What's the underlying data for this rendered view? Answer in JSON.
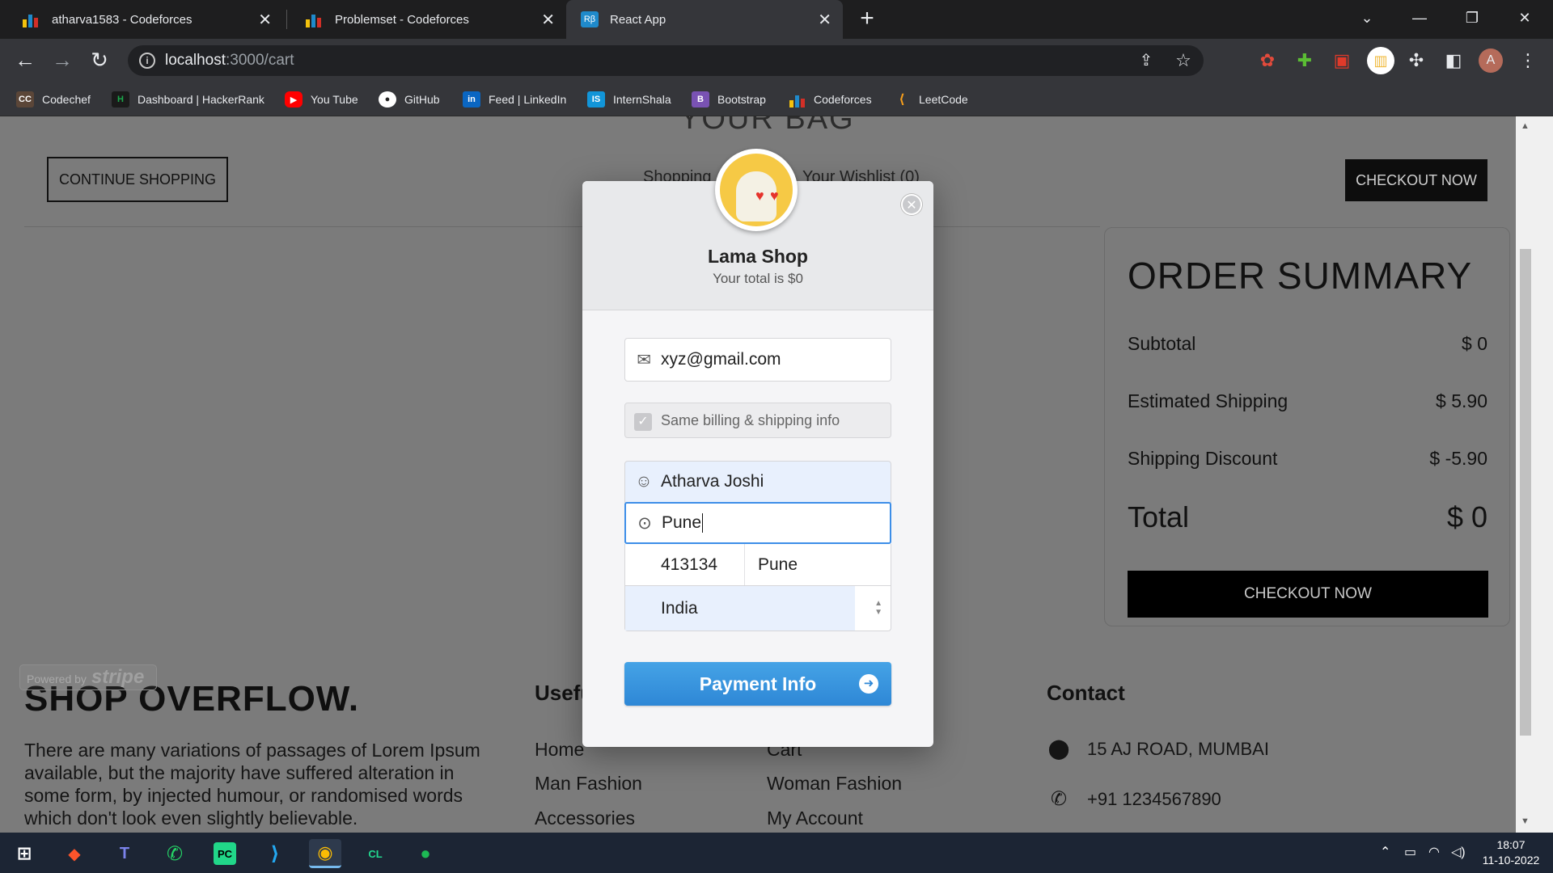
{
  "browser": {
    "tabs": [
      {
        "title": "atharva1583 - Codeforces",
        "favicon": "codeforces-icon"
      },
      {
        "title": "Problemset - Codeforces",
        "favicon": "codeforces-icon"
      },
      {
        "title": "React App",
        "favicon": "react-icon",
        "active": true
      }
    ],
    "url_host": "localhost",
    "url_path": ":3000/cart",
    "profile_initial": "A",
    "bookmarks": [
      {
        "label": "Codechef",
        "icon": "codechef-icon",
        "color": "#5b4638",
        "glyph": "CC"
      },
      {
        "label": "Dashboard | HackerRank",
        "icon": "hackerrank-icon",
        "color": "#1ba94c",
        "glyph": "H"
      },
      {
        "label": "You Tube",
        "icon": "youtube-icon",
        "color": "#ff0000",
        "glyph": "▶"
      },
      {
        "label": "GitHub",
        "icon": "github-icon",
        "color": "#222222",
        "glyph": "●"
      },
      {
        "label": "Feed | LinkedIn",
        "icon": "linkedin-icon",
        "color": "#0a66c2",
        "glyph": "in"
      },
      {
        "label": "InternShala",
        "icon": "internshala-icon",
        "color": "#1295d8",
        "glyph": "IS"
      },
      {
        "label": "Bootstrap",
        "icon": "bootstrap-icon",
        "color": "#7952b3",
        "glyph": "B"
      },
      {
        "label": "Codeforces",
        "icon": "codeforces-icon",
        "color": "#35363a",
        "glyph": "▮"
      },
      {
        "label": "LeetCode",
        "icon": "leetcode-icon",
        "color": "#35363a",
        "glyph": "⟨"
      }
    ]
  },
  "page": {
    "bag_title": "YOUR BAG",
    "continue_label": "CONTINUE SHOPPING",
    "shopping_bag_label": "Shopping",
    "wishlist_label": "Your Wishlist (0)",
    "checkout_top_label": "CHECKOUT NOW",
    "summary": {
      "title": "ORDER SUMMARY",
      "subtotal_label": "Subtotal",
      "subtotal_value": "$ 0",
      "shipping_label": "Estimated Shipping",
      "shipping_value": "$ 5.90",
      "discount_label": "Shipping Discount",
      "discount_value": "$ -5.90",
      "total_label": "Total",
      "total_value": "$ 0",
      "checkout_label": "CHECKOUT NOW"
    },
    "footer": {
      "brand": "SHOP OVERFLOW.",
      "description": "There are many variations of passages of Lorem Ipsum available, but the majority have suffered alteration in some form, by injected humour, or randomised words which don't look even slightly believable.",
      "links_heading": "Useful Links",
      "links": [
        "Home",
        "Cart",
        "Man Fashion",
        "Woman Fashion",
        "Accessories",
        "My Account"
      ],
      "contact_heading": "Contact",
      "address": "15 AJ ROAD, MUMBAI",
      "phone": "+91 1234567890"
    },
    "stripe_badge": {
      "prefix": "Powered by",
      "name": "stripe"
    }
  },
  "modal": {
    "shop_name": "Lama Shop",
    "total_text": "Your total is $0",
    "email": "xyz@gmail.com",
    "same_billing_label": "Same billing & shipping info",
    "name": "Atharva Joshi",
    "address": "Pune",
    "zip": "413134",
    "city": "Pune",
    "country": "India",
    "pay_label": "Payment Info"
  },
  "taskbar": {
    "apps": [
      "windows-start-icon",
      "brave-icon",
      "teams-icon",
      "whatsapp-icon",
      "pycharm-icon",
      "vscode-icon",
      "chrome-icon",
      "clion-icon",
      "spotify-icon"
    ],
    "time": "18:07",
    "date": "11-10-2022"
  }
}
